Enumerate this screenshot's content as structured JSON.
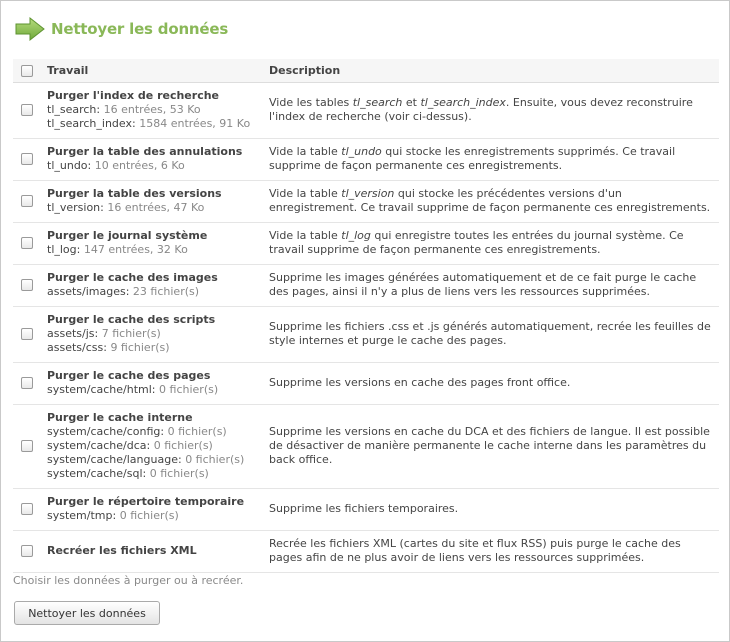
{
  "page": {
    "title": "Nettoyer les données"
  },
  "table": {
    "headers": {
      "job": "Travail",
      "description": "Description"
    },
    "rows": [
      {
        "name": "Purger l'index de recherche",
        "meta": [
          {
            "key": "tl_search:",
            "value": "16 entrées, 53 Ko"
          },
          {
            "key": "tl_search_index:",
            "value": "1584 entrées, 91 Ko"
          }
        ],
        "desc": [
          {
            "t": "Vide les tables "
          },
          {
            "t": "tl_search",
            "i": true
          },
          {
            "t": " et "
          },
          {
            "t": "tl_search_index",
            "i": true
          },
          {
            "t": ". Ensuite, vous devez reconstruire l'index de recherche (voir ci-dessus)."
          }
        ]
      },
      {
        "name": "Purger la table des annulations",
        "meta": [
          {
            "key": "tl_undo:",
            "value": "10 entrées, 6 Ko"
          }
        ],
        "desc": [
          {
            "t": "Vide la table "
          },
          {
            "t": "tl_undo",
            "i": true
          },
          {
            "t": " qui stocke les enregistrements supprimés. Ce travail supprime de façon permanente ces enregistrements."
          }
        ]
      },
      {
        "name": "Purger la table des versions",
        "meta": [
          {
            "key": "tl_version:",
            "value": "16 entrées, 47 Ko"
          }
        ],
        "desc": [
          {
            "t": "Vide la table "
          },
          {
            "t": "tl_version",
            "i": true
          },
          {
            "t": " qui stocke les précédentes versions d'un enregistrement. Ce travail supprime de façon permanente ces enregistrements."
          }
        ]
      },
      {
        "name": "Purger le journal système",
        "meta": [
          {
            "key": "tl_log:",
            "value": "147 entrées, 32 Ko"
          }
        ],
        "desc": [
          {
            "t": "Vide la table "
          },
          {
            "t": "tl_log",
            "i": true
          },
          {
            "t": " qui enregistre toutes les entrées du journal système. Ce travail supprime de façon permanente ces enregistrements."
          }
        ]
      },
      {
        "name": "Purger le cache des images",
        "meta": [
          {
            "key": "assets/images:",
            "value": "23 fichier(s)"
          }
        ],
        "desc": [
          {
            "t": "Supprime les images générées automatiquement et de ce fait purge le cache des pages, ainsi il n'y a plus de liens vers les ressources supprimées."
          }
        ]
      },
      {
        "name": "Purger le cache des scripts",
        "meta": [
          {
            "key": "assets/js:",
            "value": "7 fichier(s)"
          },
          {
            "key": "assets/css:",
            "value": "9 fichier(s)"
          }
        ],
        "desc": [
          {
            "t": "Supprime les fichiers .css et .js générés automatiquement, recrée les feuilles de style internes et purge le cache des pages."
          }
        ]
      },
      {
        "name": "Purger le cache des pages",
        "meta": [
          {
            "key": "system/cache/html:",
            "value": "0 fichier(s)"
          }
        ],
        "desc": [
          {
            "t": "Supprime les versions en cache des pages front office."
          }
        ]
      },
      {
        "name": "Purger le cache interne",
        "meta": [
          {
            "key": "system/cache/config:",
            "value": "0 fichier(s)"
          },
          {
            "key": "system/cache/dca:",
            "value": "0 fichier(s)"
          },
          {
            "key": "system/cache/language:",
            "value": "0 fichier(s)"
          },
          {
            "key": "system/cache/sql:",
            "value": "0 fichier(s)"
          }
        ],
        "desc": [
          {
            "t": "Supprime les versions en cache du DCA et des fichiers de langue. Il est possible de désactiver de manière permanente le cache interne dans les paramètres du back office."
          }
        ]
      },
      {
        "name": "Purger le répertoire temporaire",
        "meta": [
          {
            "key": "system/tmp:",
            "value": "0 fichier(s)"
          }
        ],
        "desc": [
          {
            "t": "Supprime les fichiers temporaires."
          }
        ]
      },
      {
        "name": "Recréer les fichiers XML",
        "meta": [],
        "desc": [
          {
            "t": "Recrée les fichiers XML (cartes du site et flux RSS) puis purge le cache des pages afin de ne plus avoir de liens vers les ressources supprimées."
          }
        ]
      }
    ]
  },
  "hint": "Choisir les données à purger ou à recréer.",
  "submit_label": "Nettoyer les données",
  "colors": {
    "accent": "#8ab858",
    "muted": "#888888"
  }
}
